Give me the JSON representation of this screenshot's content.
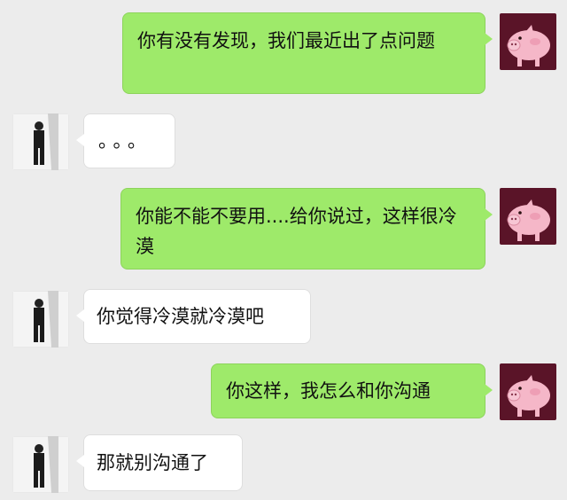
{
  "messages": [
    {
      "sender": "me",
      "text": "你有没有发现，我们最近出了点问题",
      "avatar": "pig-icon"
    },
    {
      "sender": "other",
      "text": "。。。",
      "avatar": "person-photo-icon"
    },
    {
      "sender": "me",
      "text": "你能不能不要用....给你说过，这样很冷漠",
      "avatar": "pig-icon"
    },
    {
      "sender": "other",
      "text": "你觉得冷漠就冷漠吧",
      "avatar": "person-photo-icon"
    },
    {
      "sender": "me",
      "text": "你这样，我怎么和你沟通",
      "avatar": "pig-icon"
    },
    {
      "sender": "other",
      "text": "那就别沟通了",
      "avatar": "person-photo-icon"
    }
  ],
  "colors": {
    "background": "#ececec",
    "sent_bubble": "#9eea6a",
    "received_bubble": "#ffffff",
    "pig_avatar_bg": "#5a1428",
    "pig_color": "#f5b7c8"
  }
}
